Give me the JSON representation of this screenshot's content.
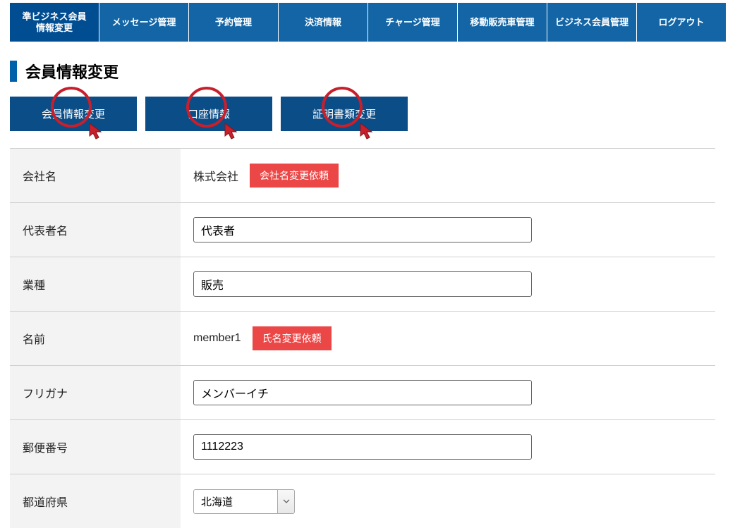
{
  "topnav": {
    "items": [
      "準ビジネス会員\n情報変更",
      "メッセージ管理",
      "予約管理",
      "決済情報",
      "チャージ管理",
      "移動販売車管理",
      "ビジネス会員管理",
      "ログアウト"
    ],
    "active_index": 0
  },
  "page_title": "会員情報変更",
  "tabs": [
    {
      "label": "会員情報変更"
    },
    {
      "label": "口座情報"
    },
    {
      "label": "証明書類変更"
    }
  ],
  "form": {
    "rows": [
      {
        "label": "会社名",
        "type": "static_with_button",
        "value": "株式会社",
        "button_label": "会社名変更依頼"
      },
      {
        "label": "代表者名",
        "type": "input",
        "value": "代表者"
      },
      {
        "label": "業種",
        "type": "input",
        "value": "販売"
      },
      {
        "label": "名前",
        "type": "static_with_button",
        "value": "member1",
        "button_label": "氏名変更依頼"
      },
      {
        "label": "フリガナ",
        "type": "input",
        "value": "メンバーイチ"
      },
      {
        "label": "郵便番号",
        "type": "input",
        "value": "1112223"
      },
      {
        "label": "都道府県",
        "type": "select",
        "value": "北海道"
      }
    ]
  }
}
